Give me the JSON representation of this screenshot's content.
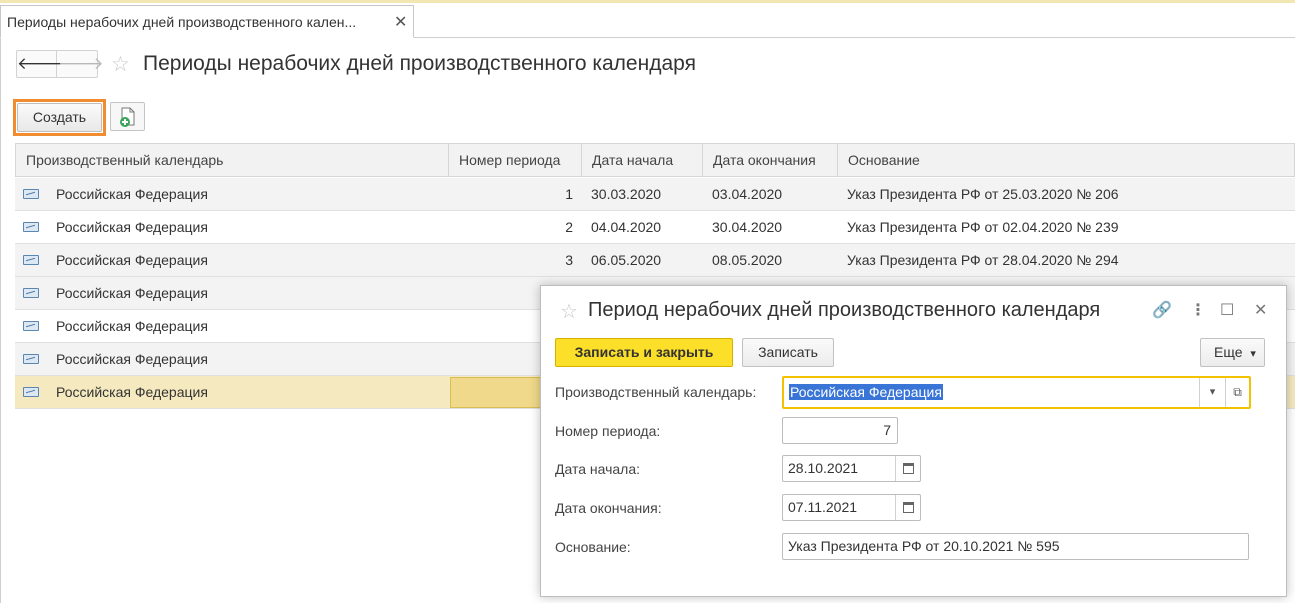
{
  "tab": {
    "title": "Периоды нерабочих дней производственного кален...",
    "close": "✕"
  },
  "nav": {
    "back": "🡐",
    "forward": "🡒"
  },
  "page": {
    "title": "Периоды нерабочих дней производственного календаря",
    "star": "☆"
  },
  "toolbar": {
    "create_label": "Создать"
  },
  "table": {
    "columns": [
      "Производственный календарь",
      "Номер периода",
      "Дата начала",
      "Дата окончания",
      "Основание"
    ],
    "rows": [
      {
        "calendar": "Российская Федерация",
        "number": "1",
        "start": "30.03.2020",
        "end": "03.04.2020",
        "basis": "Указ Президента РФ от 25.03.2020 № 206"
      },
      {
        "calendar": "Российская Федерация",
        "number": "2",
        "start": "04.04.2020",
        "end": "30.04.2020",
        "basis": "Указ Президента РФ от 02.04.2020 № 239"
      },
      {
        "calendar": "Российская Федерация",
        "number": "3",
        "start": "06.05.2020",
        "end": "08.05.2020",
        "basis": "Указ Президента РФ от 28.04.2020 № 294"
      },
      {
        "calendar": "Российская Федерация"
      },
      {
        "calendar": "Российская Федерация"
      },
      {
        "calendar": "Российская Федерация"
      },
      {
        "calendar": "Российская Федерация"
      }
    ],
    "selected_row": 6
  },
  "dialog": {
    "title": "Период нерабочих дней производственного календаря",
    "star": "☆",
    "controls": {
      "link": "🔗",
      "menu": "⋮",
      "maximize": "☐",
      "close": "✕"
    },
    "save_close_label": "Записать и закрыть",
    "save_label": "Записать",
    "more_label": "Еще",
    "more_arrow": "▾",
    "fields": {
      "calendar": {
        "label": "Производственный календарь:",
        "value": "Российская Федерация"
      },
      "number": {
        "label": "Номер периода:",
        "value": "7"
      },
      "start": {
        "label": "Дата начала:",
        "value": "28.10.2021"
      },
      "end": {
        "label": "Дата окончания:",
        "value": "07.11.2021"
      },
      "basis": {
        "label": "Основание:",
        "value": "Указ Президента РФ от 20.10.2021 № 595"
      }
    },
    "dropdown_arrow": "▾",
    "open_icon": "⧉"
  },
  "colors": {
    "accent_yellow": "#fcdf28",
    "highlight_orange": "#f28c30",
    "selected_row": "#f5e9bf"
  }
}
